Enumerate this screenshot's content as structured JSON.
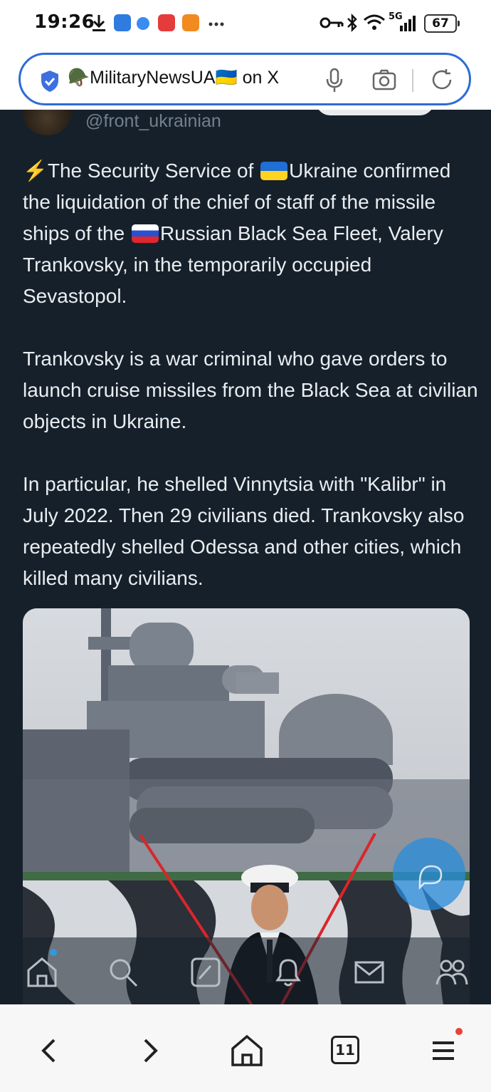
{
  "status_bar": {
    "time": "19:26",
    "network": "5G",
    "battery": "67"
  },
  "browser": {
    "url_title": "🪖MilitaryNewsUA🇺🇦 on X",
    "tab_count": "11"
  },
  "tweet": {
    "handle": "@front_ukrainian",
    "paragraph1": {
      "prefix": "The Security Service of ",
      "country": "Ukraine",
      "middle": " confirmed the liquidation of the chief of staff of the missile ships of the ",
      "rest": "Russian Black Sea Fleet, Valery Trankovsky, in the temporarily occupied Sevastopol."
    },
    "paragraph2": "Trankovsky is a war criminal who gave orders to launch cruise missiles from the Black Sea at civilian objects in Ukraine.",
    "paragraph3": "In particular, he shelled Vinnytsia with \"Kalibr\" in July 2022. Then 29 civilians died. Trankovsky also repeatedly shelled Odessa and other cities, which killed many civilians."
  },
  "icons": {
    "status": [
      "download-icon",
      "app-icon",
      "app-icon",
      "huawei-app-icon",
      "video-app-icon",
      "more-icon",
      "key-icon",
      "bluetooth-icon",
      "wifi-icon",
      "signal-icon",
      "battery-icon"
    ],
    "url_bar": [
      "shield-check-icon",
      "microphone-icon",
      "camera-icon",
      "reload-icon"
    ],
    "x_nav": [
      "home-icon",
      "search-icon",
      "compose-icon",
      "notifications-icon",
      "messages-icon",
      "communities-icon"
    ],
    "browser_bar": [
      "back-icon",
      "forward-icon",
      "home-icon",
      "tabs-icon",
      "menu-icon"
    ]
  },
  "colors": {
    "background": "#16202b",
    "accent": "#2e6bd6",
    "text": "#e9edf0",
    "secondary_text": "#71808e"
  }
}
